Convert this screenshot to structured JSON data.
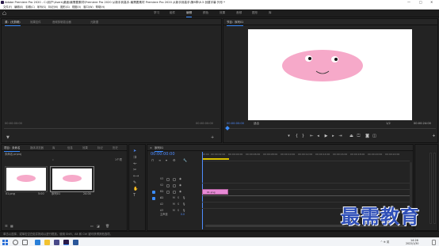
{
  "window": {
    "title": "Adobe Premiere Pro 2020 - C:\\用户\\Users\\桌面\\最需要素材\\Premiere Pro 2020 从新手到高手-最需要素材 Premiere Pro 2020 从新手到高手\\第8章\\8.3 创建字幕 外形 *",
    "minimize": "—",
    "maximize": "□",
    "close": "✕"
  },
  "menu": [
    "文件(F)",
    "编辑(E)",
    "剪辑(C)",
    "序列(S)",
    "标记(M)",
    "图形(G)",
    "视图(V)",
    "窗口(W)",
    "帮助(H)"
  ],
  "workspace": {
    "tabs": [
      "学习",
      "组件",
      "编辑",
      "颜色",
      "效果",
      "音频",
      "图形",
      "库"
    ],
    "active": "编辑"
  },
  "source_panel": {
    "tabs": [
      "源：(无剪辑)",
      "效果控件",
      "音频剪辑混合器",
      "元数据"
    ],
    "timecode_left": "00:00:00:00",
    "timecode_right": "00:00:00:00"
  },
  "program_panel": {
    "tab": "节目：序列01",
    "timecode": "00:00:00:00",
    "fit": "适合",
    "ratio": "1/2",
    "duration": "00:00:24:00"
  },
  "project_panel": {
    "tabs": [
      "项目：未命名",
      "媒体浏览器",
      "库",
      "信息",
      "效果",
      "标记",
      "历史"
    ],
    "path": "未命名.prproj",
    "items": [
      {
        "name": "01.png",
        "duration": "5:00"
      },
      {
        "name": "序列01",
        "duration": "24:00"
      }
    ],
    "count": "1个项"
  },
  "timeline": {
    "tab": "序列01",
    "timecode": "00:00:00:00",
    "ruler": [
      "00:00",
      "00:00:02:00",
      "00:00:04:00",
      "00:00:06:00",
      "00:00:08:00",
      "00:00:10:00",
      "00:00:12:00",
      "00:00:14:00",
      "00:00:16:00",
      "00:00:18:00",
      "00:00:20:00",
      "00:00:22:00"
    ],
    "tracks": [
      "V3",
      "V2",
      "V1",
      "A1",
      "A2",
      "A3"
    ],
    "master": "主声道",
    "master_value": "0.0",
    "clip": "01.png"
  },
  "status_bar": "单击以选择，或单击空白处并拖动以进行框选。使用 Shift、Alt 和 Ctrl 键可获得其他选项。",
  "watermark": "最需教育",
  "taskbar": {
    "time": "14:26",
    "date": "2022/1/30",
    "tray": "^ ⊕ 英"
  },
  "colors": {
    "accent": "#3a8cff",
    "pig_pink": "#f6a9c9",
    "clip_pink": "#e78ad6",
    "watermark_blue": "#2f4fb8"
  }
}
